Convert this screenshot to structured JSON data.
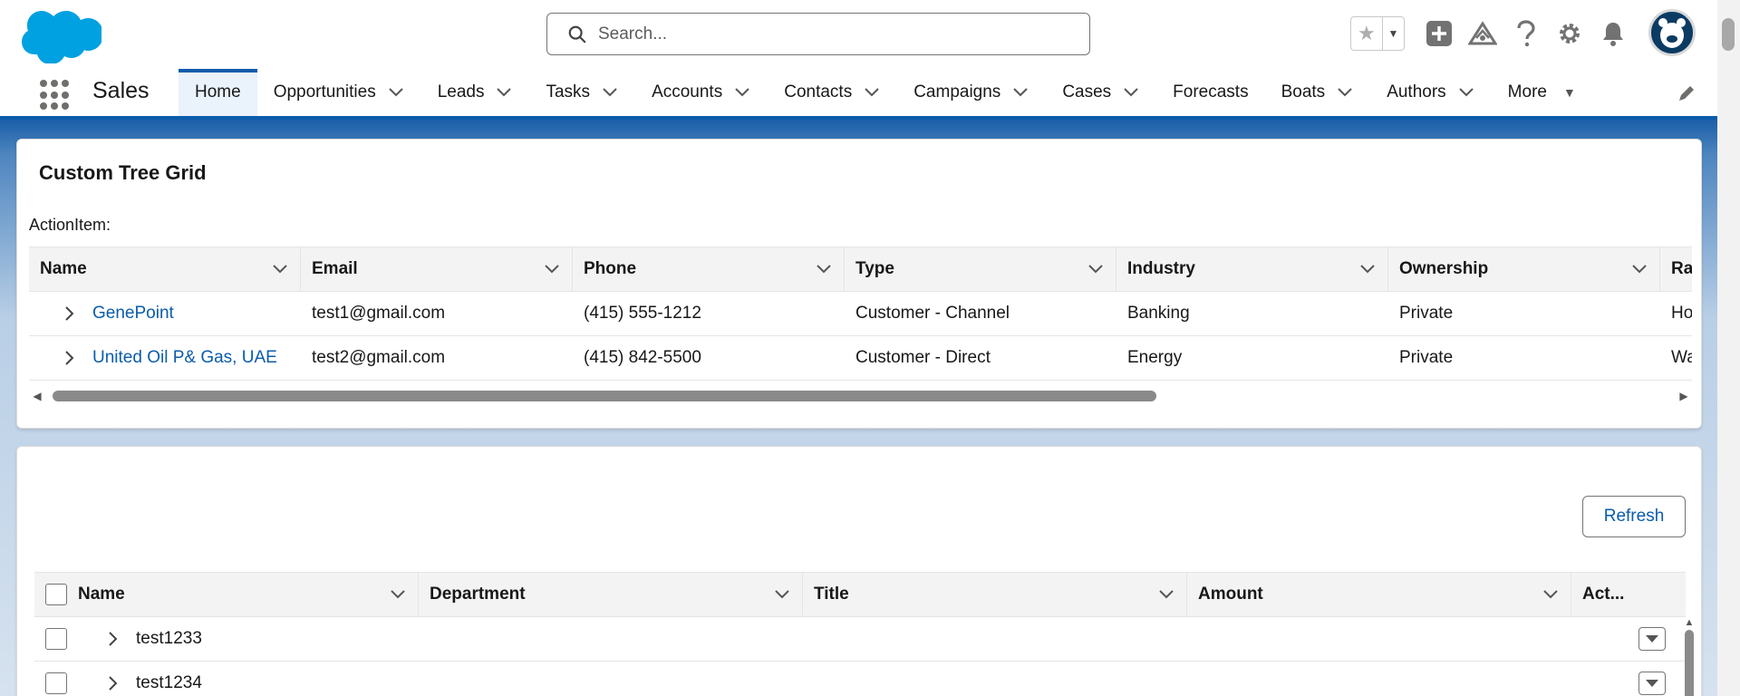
{
  "header": {
    "search_placeholder": "Search...",
    "icons": [
      "favorites-star-icon",
      "add-icon",
      "trailhead-icon",
      "help-icon",
      "setup-gear-icon",
      "notifications-bell-icon",
      "user-avatar"
    ]
  },
  "nav": {
    "app_name": "Sales",
    "tabs": [
      {
        "label": "Home",
        "active": true,
        "has_menu": false
      },
      {
        "label": "Opportunities",
        "has_menu": true
      },
      {
        "label": "Leads",
        "has_menu": true
      },
      {
        "label": "Tasks",
        "has_menu": true
      },
      {
        "label": "Accounts",
        "has_menu": true
      },
      {
        "label": "Contacts",
        "has_menu": true
      },
      {
        "label": "Campaigns",
        "has_menu": true
      },
      {
        "label": "Cases",
        "has_menu": true
      },
      {
        "label": "Forecasts",
        "has_menu": false
      },
      {
        "label": "Boats",
        "has_menu": true
      },
      {
        "label": "Authors",
        "has_menu": true
      }
    ],
    "more_label": "More"
  },
  "card1": {
    "title": "Custom Tree Grid",
    "action_label": "ActionItem:",
    "columns": [
      "Name",
      "Email",
      "Phone",
      "Type",
      "Industry",
      "Ownership",
      "Ra"
    ],
    "rows": [
      {
        "name": "GenePoint",
        "email": "test1@gmail.com",
        "phone": "(415) 555-1212",
        "type": "Customer - Channel",
        "industry": "Banking",
        "ownership": "Private",
        "rating": "Ho"
      },
      {
        "name": "United Oil P& Gas, UAE",
        "email": "test2@gmail.com",
        "phone": "(415) 842-5500",
        "type": "Customer - Direct",
        "industry": "Energy",
        "ownership": "Private",
        "rating": "Wa"
      }
    ]
  },
  "card2": {
    "refresh_label": "Refresh",
    "columns": [
      "Name",
      "Department",
      "Title",
      "Amount",
      "Act..."
    ],
    "rows": [
      {
        "name": "test1233"
      },
      {
        "name": "test1234"
      }
    ]
  },
  "colors": {
    "brand_blue": "#0b5cab",
    "link": "#0b5cab",
    "header_bg": "#f3f3f3"
  }
}
